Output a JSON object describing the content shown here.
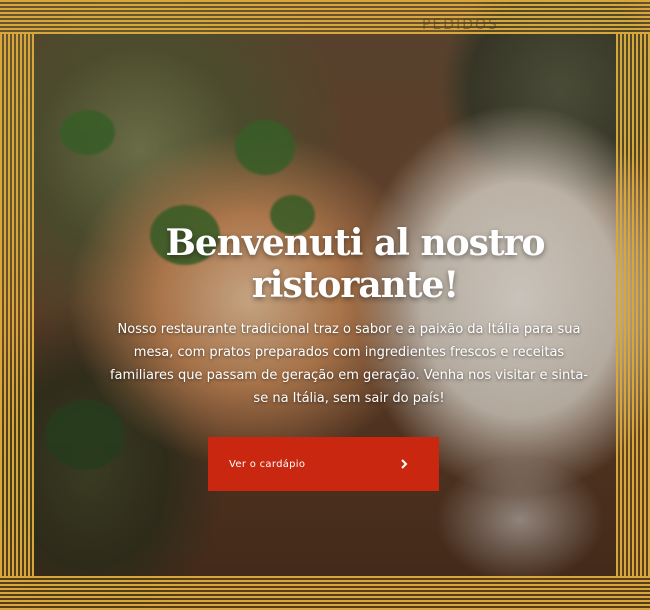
{
  "nav": {
    "items": [
      "PEDIDOS",
      ""
    ]
  },
  "hero": {
    "title": "Benvenuti al nostro ristorante!",
    "description": "Nosso restaurante tradicional traz o sabor e a paixão da Itália para sua mesa, com pratos preparados com ingredientes frescos e receitas familiares que passam de geração em geração. Venha nos visitar e sinta-se na Itália, sem sair do país!",
    "cta_label": "Ver o cardápio",
    "cta_icon": "chevron-right-icon"
  },
  "colors": {
    "accent": "#c9270f",
    "border_gold": "#d7a73a",
    "text": "#ffffff"
  }
}
